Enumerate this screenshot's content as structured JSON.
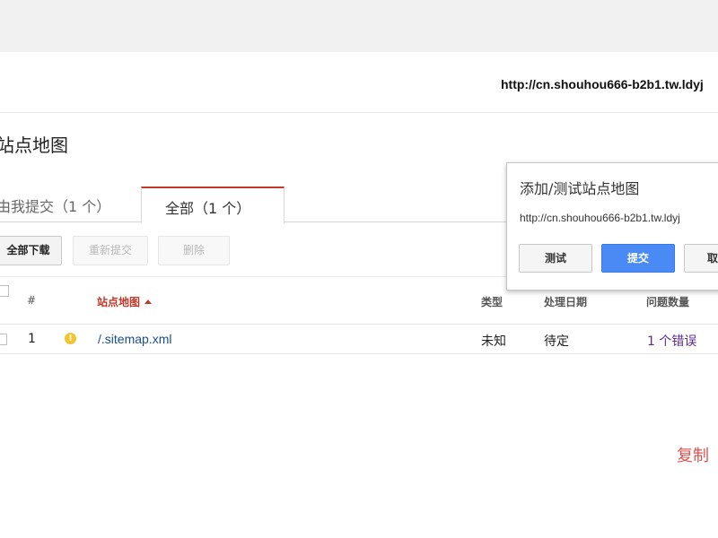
{
  "header": {
    "url": "http://cn.shouhou666-b2b1.tw.ldyj"
  },
  "page": {
    "title": "站点地图"
  },
  "tabs": [
    {
      "label": "由我提交（1 个）",
      "active": false
    },
    {
      "label": "全部（1 个）",
      "active": true
    }
  ],
  "toolbar": {
    "download_all": "全部下载",
    "resubmit": "重新提交",
    "delete": "删除"
  },
  "table": {
    "headers": {
      "number": "#",
      "sitemap": "站点地图",
      "type": "类型",
      "processed_date": "处理日期",
      "issues": "问题数量"
    },
    "rows": [
      {
        "number": "1",
        "status_icon": "warning-icon",
        "status_icon_glyph": "!",
        "path": "/.sitemap.xml",
        "type": "未知",
        "processed_date": "待定",
        "issues": "1 个错误"
      }
    ]
  },
  "popup": {
    "title": "添加/测试站点地图",
    "url_value": "http://cn.shouhou666-b2b1.tw.ldyj",
    "test_label": "测试",
    "submit_label": "提交",
    "cancel_label": "取"
  },
  "watermark": {
    "text": "复制"
  },
  "colors": {
    "accent_red": "#c0392b",
    "primary_blue": "#4a8af4",
    "link_blue": "#1a4d8f",
    "error_purple": "#5a2a9a",
    "warning_yellow": "#f4c430"
  }
}
